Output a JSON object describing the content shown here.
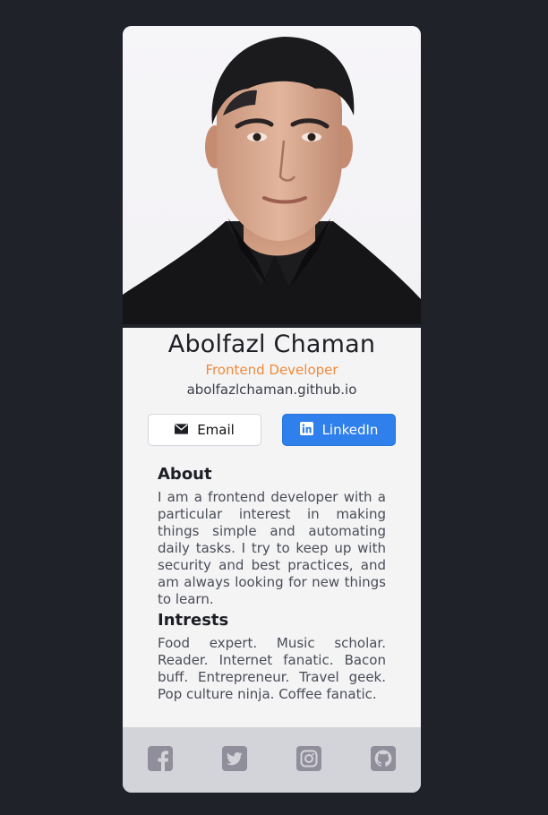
{
  "profile": {
    "name": "Abolfazl Chaman",
    "role": "Frontend Developer",
    "website": "abolfazlchaman.github.io"
  },
  "buttons": {
    "email_label": "Email",
    "linkedin_label": "LinkedIn"
  },
  "about": {
    "title": "About",
    "text": "I am a frontend developer with a particular interest in making things simple and automating daily tasks. I try to keep up with security and best practices, and am always looking for new things to learn."
  },
  "interests": {
    "title": "Intrests",
    "text": "Food expert. Music scholar. Reader. Internet fanatic. Bacon buff. Entrepreneur. Travel geek. Pop culture ninja. Coffee fanatic."
  },
  "footer": {
    "icons": [
      "facebook-icon",
      "twitter-icon",
      "instagram-icon",
      "github-icon"
    ]
  },
  "colors": {
    "page_background": "#1f2229",
    "card_background": "#f4f4f5",
    "accent_orange": "#f08a3a",
    "linkedin_blue": "#2f80ed",
    "footer_background": "#d3d4da",
    "footer_icon": "#918e9b"
  }
}
